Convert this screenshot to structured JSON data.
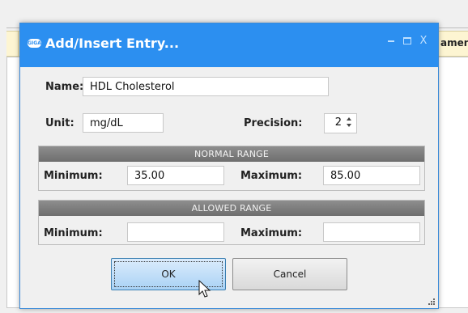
{
  "background": {
    "column_header": "ament"
  },
  "dialog": {
    "title": "Add/Insert Entry...",
    "app_icon_text": "GIGA",
    "close_glyph": "X",
    "fields": {
      "name_label": "Name:",
      "name_value": "HDL Cholesterol",
      "unit_label": "Unit:",
      "unit_value": "mg/dL",
      "precision_label": "Precision:",
      "precision_value": "2"
    },
    "normal_range": {
      "header": "NORMAL RANGE",
      "min_label": "Minimum:",
      "min_value": "35.00",
      "max_label": "Maximum:",
      "max_value": "85.00"
    },
    "allowed_range": {
      "header": "ALLOWED RANGE",
      "min_label": "Minimum:",
      "min_value": "",
      "max_label": "Maximum:",
      "max_value": ""
    },
    "buttons": {
      "ok": "OK",
      "cancel": "Cancel"
    }
  },
  "colors": {
    "titlebar": "#2c8ff0",
    "dialog_bg": "#f0f0f0",
    "group_header": "#7f7f7f",
    "ok_button": "#bcdcf7"
  },
  "icons": [
    "app-icon",
    "minimize-icon",
    "maximize-icon",
    "close-icon",
    "spinner-up-icon",
    "spinner-down-icon",
    "mouse-cursor-icon",
    "resize-grip-icon"
  ]
}
